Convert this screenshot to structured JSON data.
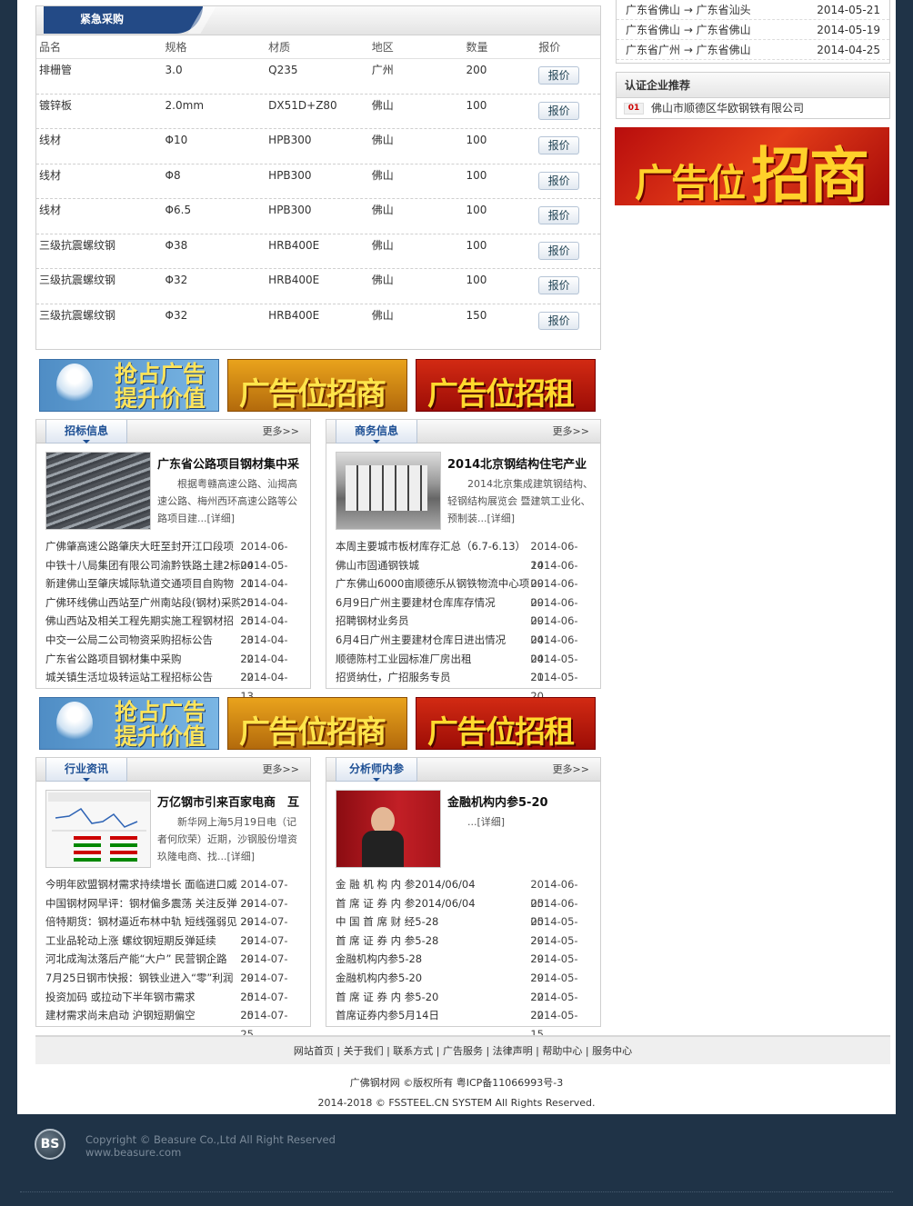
{
  "urgent": {
    "title": "紧急采购",
    "headers": [
      "品名",
      "规格",
      "材质",
      "地区",
      "数量",
      "报价"
    ],
    "rows": [
      {
        "name": "排栅管",
        "spec": "3.0",
        "material": "Q235",
        "area": "广州",
        "qty": "200",
        "btn": "报价"
      },
      {
        "name": "镀锌板",
        "spec": "2.0mm",
        "material": "DX51D+Z80",
        "area": "佛山",
        "qty": "100",
        "btn": "报价"
      },
      {
        "name": "线材",
        "spec": "Φ10",
        "material": "HPB300",
        "area": "佛山",
        "qty": "100",
        "btn": "报价"
      },
      {
        "name": "线材",
        "spec": "Φ8",
        "material": "HPB300",
        "area": "佛山",
        "qty": "100",
        "btn": "报价"
      },
      {
        "name": "线材",
        "spec": "Φ6.5",
        "material": "HPB300",
        "area": "佛山",
        "qty": "100",
        "btn": "报价"
      },
      {
        "name": "三级抗震螺纹钢",
        "spec": "Φ38",
        "material": "HRB400E",
        "area": "佛山",
        "qty": "100",
        "btn": "报价"
      },
      {
        "name": "三级抗震螺纹钢",
        "spec": "Φ32",
        "material": "HRB400E",
        "area": "佛山",
        "qty": "100",
        "btn": "报价"
      },
      {
        "name": "三级抗震螺纹钢",
        "spec": "Φ32",
        "material": "HRB400E",
        "area": "佛山",
        "qty": "150",
        "btn": "报价"
      }
    ]
  },
  "routes": [
    {
      "route": "广东省佛山 → 广东省汕头",
      "date": "2014-05-21"
    },
    {
      "route": "广东省佛山 → 广东省佛山",
      "date": "2014-05-19"
    },
    {
      "route": "广东省广州 → 广东省佛山",
      "date": "2014-04-25"
    }
  ],
  "cert": {
    "title": "认证企业推荐",
    "rank": "01",
    "company": "佛山市顺德区华欧钢铁有限公司"
  },
  "side_ad": {
    "big": "广告位",
    "big2": "招商"
  },
  "banners": {
    "b1": "抢占广告\n提升价值",
    "b2": "广告位招商",
    "b3": "广告位招租"
  },
  "panels": {
    "bidding": {
      "tab": "招标信息",
      "more": "更多>>",
      "feature_title": "广东省公路项目钢材集中采",
      "feature_desc": "根据粤赣高速公路、汕揭高速公路、梅州西环高速公路等公路项目建...",
      "feature_more": "[详细]",
      "items": [
        {
          "t": "广佛肇高速公路肇庆大旺至封开江口段项",
          "d": "2014-06-04"
        },
        {
          "t": "中铁十八局集团有限公司渝黔铁路土建2标",
          "d": "2014-05-21"
        },
        {
          "t": "新建佛山至肇庆城际轨道交通项目自购物",
          "d": "2014-04-25"
        },
        {
          "t": "广佛环线佛山西站至广州南站段(钢材)采购",
          "d": "2014-04-25"
        },
        {
          "t": "佛山西站及相关工程先期实施工程钢材招",
          "d": "2014-04-23"
        },
        {
          "t": "中交一公局二公司物资采购招标公告",
          "d": "2014-04-22"
        },
        {
          "t": "广东省公路项目钢材集中采购",
          "d": "2014-04-22"
        },
        {
          "t": "城关镇生活垃圾转运站工程招标公告",
          "d": "2014-04-13"
        }
      ]
    },
    "business": {
      "tab": "商务信息",
      "more": "更多>>",
      "feature_title": "2014北京钢结构住宅产业",
      "feature_desc": "2014北京集成建筑钢结构、轻钢结构展览会 暨建筑工业化、预制装...",
      "feature_more": "[详细]",
      "items": [
        {
          "t": "本周主要城市板材库存汇总（6.7-6.13）",
          "d": "2014-06-14"
        },
        {
          "t": "佛山市固通钢铁城",
          "d": "2014-06-09"
        },
        {
          "t": "广东佛山6000亩顺德乐从钢铁物流中心项",
          "d": "2014-06-09"
        },
        {
          "t": "6月9日广州主要建材仓库库存情况",
          "d": "2014-06-09"
        },
        {
          "t": "招聘钢材业务员",
          "d": "2014-06-04"
        },
        {
          "t": "6月4日广州主要建材仓库日进出情况",
          "d": "2014-06-04"
        },
        {
          "t": "顺德陈村工业园标准厂房出租",
          "d": "2014-05-21"
        },
        {
          "t": "招贤纳仕，广招服务专员",
          "d": "2014-05-20"
        }
      ]
    },
    "industry": {
      "tab": "行业资讯",
      "more": "更多>>",
      "feature_title": "万亿钢市引来百家电商　互",
      "feature_desc": "新华网上海5月19日电（记者何欣荣）近期，沙钢股份增资玖隆电商、找...",
      "feature_more": "[详细]",
      "items": [
        {
          "t": "今明年欧盟钢材需求持续增长 面临进口威",
          "d": "2014-07-29"
        },
        {
          "t": "中国钢材网早评：钢材偏多震荡 关注反弹",
          "d": "2014-07-29"
        },
        {
          "t": "倍特期货：钢材逼近布林中轨 短线强弱见",
          "d": "2014-07-29"
        },
        {
          "t": "工业品轮动上涨 螺纹钢短期反弹延续",
          "d": "2014-07-29"
        },
        {
          "t": "河北成淘汰落后产能“大户” 民营钢企路",
          "d": "2014-07-29"
        },
        {
          "t": "7月25日钢市快报：钢铁业进入“零”利润",
          "d": "2014-07-25"
        },
        {
          "t": "投资加码 或拉动下半年钢市需求",
          "d": "2014-07-25"
        },
        {
          "t": "建材需求尚未启动 沪钢短期偏空",
          "d": "2014-07-25"
        }
      ]
    },
    "analyst": {
      "tab": "分析师内参",
      "more": "更多>>",
      "feature_title": "金融机构内参5-20",
      "feature_desc": "...",
      "feature_more": "[详细]",
      "items": [
        {
          "t": "金 融 机 构 内 参2014/06/04",
          "d": "2014-06-05"
        },
        {
          "t": "首 席 证 券 内 参2014/06/04",
          "d": "2014-06-05"
        },
        {
          "t": "中 国 首 席 财 经5-28",
          "d": "2014-05-29"
        },
        {
          "t": "首 席 证 券 内 参5-28",
          "d": "2014-05-29"
        },
        {
          "t": "金融机构内参5-28",
          "d": "2014-05-29"
        },
        {
          "t": "金融机构内参5-20",
          "d": "2014-05-22"
        },
        {
          "t": "首 席 证 券 内 参5-20",
          "d": "2014-05-22"
        },
        {
          "t": "首席证券内参5月14日",
          "d": "2014-05-15"
        }
      ]
    }
  },
  "footer": {
    "links": "网站首页 | 关于我们 | 联系方式 | 广告服务 | 法律声明 | 帮助中心 | 服务中心",
    "copyright1": "广佛钢材网 ©版权所有 粤ICP备11066993号-3",
    "copyright2": "2014-2018 © FSSTEEL.CN SYSTEM All Rights Reserved."
  },
  "brand": {
    "logo": "BS",
    "line1": "Copyright © Beasure Co.,Ltd All Right Reserved",
    "line2": "www.beasure.com"
  }
}
